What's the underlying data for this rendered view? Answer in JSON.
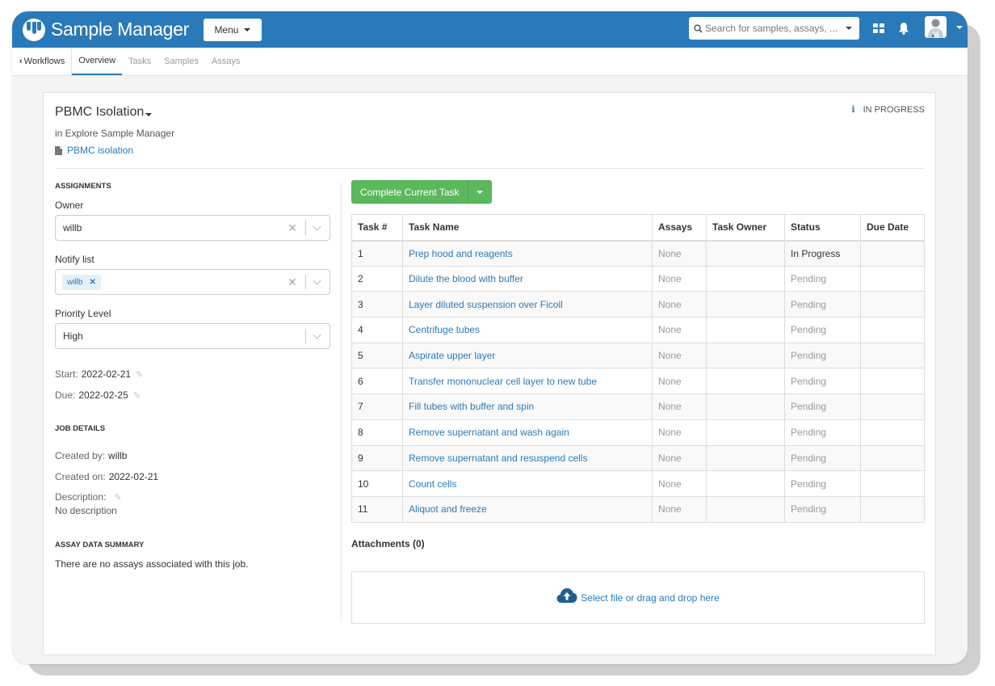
{
  "app": {
    "name": "Sample Manager",
    "menu_label": "Menu",
    "search_placeholder": "Search for samples, assays, ...",
    "icons": {
      "logo": "sample-manager-logo",
      "grid": "apps-grid-icon",
      "bell": "notifications-bell-icon",
      "avatar": "user-avatar"
    },
    "brand_color": "#2a7ab9"
  },
  "subnav": {
    "back_label": "Workflows",
    "tabs": [
      {
        "label": "Overview",
        "active": true
      },
      {
        "label": "Tasks",
        "active": false
      },
      {
        "label": "Samples",
        "active": false
      },
      {
        "label": "Assays",
        "active": false
      }
    ]
  },
  "job": {
    "title": "PBMC Isolation",
    "project": "in Explore Sample Manager",
    "protocol_link": "PBMC isolation",
    "status": "IN PROGRESS"
  },
  "assignments": {
    "heading": "ASSIGNMENTS",
    "owner_label": "Owner",
    "owner_value": "willb",
    "notify_label": "Notify list",
    "notify_chips": [
      "willb"
    ],
    "priority_label": "Priority Level",
    "priority_value": "High",
    "start_label": "Start:",
    "start_value": "2022-02-21",
    "due_label": "Due:",
    "due_value": "2022-02-25"
  },
  "job_details": {
    "heading": "JOB DETAILS",
    "created_by_label": "Created by:",
    "created_by_value": "willb",
    "created_on_label": "Created on:",
    "created_on_value": "2022-02-21",
    "description_label": "Description:",
    "description_value": "No description"
  },
  "assay_summary": {
    "heading": "ASSAY DATA SUMMARY",
    "text": "There are no assays associated with this job."
  },
  "actions": {
    "complete_label": "Complete Current Task"
  },
  "tasks": {
    "columns": [
      "Task #",
      "Task Name",
      "Assays",
      "Task Owner",
      "Status",
      "Due Date"
    ],
    "rows": [
      {
        "num": "1",
        "name": "Prep hood and reagents",
        "assays": "None",
        "owner": "",
        "status": "In Progress",
        "due": ""
      },
      {
        "num": "2",
        "name": "Dilute the blood with buffer",
        "assays": "None",
        "owner": "",
        "status": "Pending",
        "due": ""
      },
      {
        "num": "3",
        "name": "Layer diluted suspension over Ficoll",
        "assays": "None",
        "owner": "",
        "status": "Pending",
        "due": ""
      },
      {
        "num": "4",
        "name": "Centrifuge tubes",
        "assays": "None",
        "owner": "",
        "status": "Pending",
        "due": ""
      },
      {
        "num": "5",
        "name": "Aspirate upper layer",
        "assays": "None",
        "owner": "",
        "status": "Pending",
        "due": ""
      },
      {
        "num": "6",
        "name": "Transfer mononuclear cell layer to new tube",
        "assays": "None",
        "owner": "",
        "status": "Pending",
        "due": ""
      },
      {
        "num": "7",
        "name": "Fill tubes with buffer and spin",
        "assays": "None",
        "owner": "",
        "status": "Pending",
        "due": ""
      },
      {
        "num": "8",
        "name": "Remove supernatant and wash again",
        "assays": "None",
        "owner": "",
        "status": "Pending",
        "due": ""
      },
      {
        "num": "9",
        "name": "Remove supernatant and resuspend cells",
        "assays": "None",
        "owner": "",
        "status": "Pending",
        "due": ""
      },
      {
        "num": "10",
        "name": "Count cells",
        "assays": "None",
        "owner": "",
        "status": "Pending",
        "due": ""
      },
      {
        "num": "11",
        "name": "Aliquot and freeze",
        "assays": "None",
        "owner": "",
        "status": "Pending",
        "due": ""
      }
    ]
  },
  "attachments": {
    "heading": "Attachments (0)",
    "dropzone_text": "Select file or drag and drop here"
  }
}
